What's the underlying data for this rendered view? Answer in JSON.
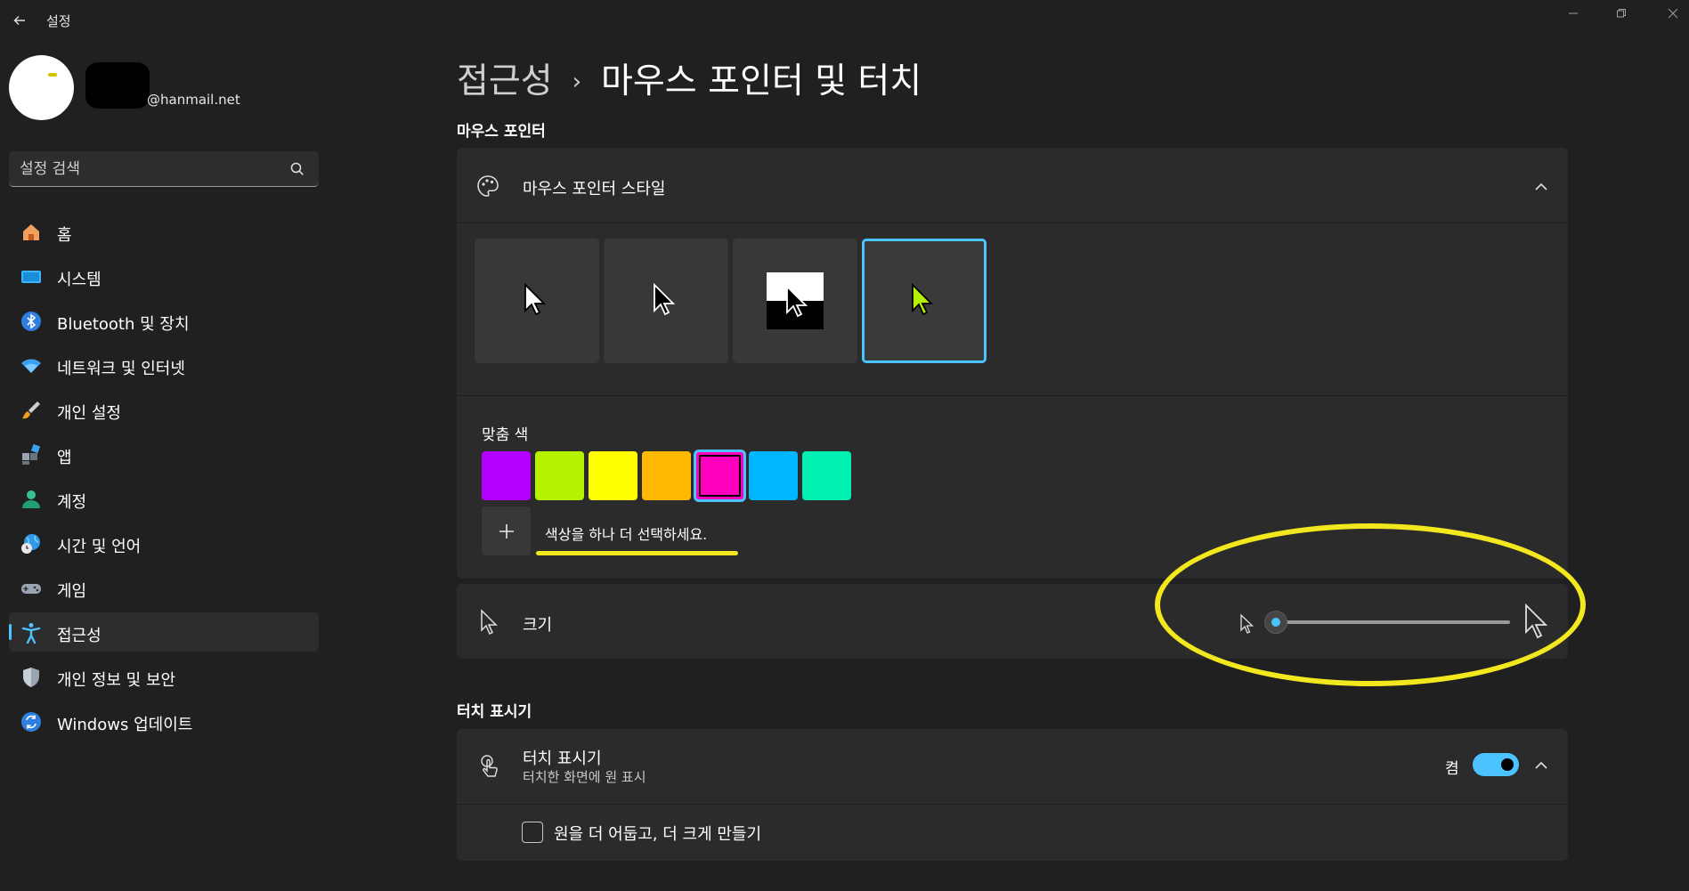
{
  "app": {
    "title": "설정"
  },
  "profile": {
    "email": "@hanmail.net"
  },
  "search": {
    "placeholder": "설정 검색"
  },
  "sidebar": {
    "items": [
      {
        "label": "홈",
        "icon": "home-icon"
      },
      {
        "label": "시스템",
        "icon": "system-icon"
      },
      {
        "label": "Bluetooth 및 장치",
        "icon": "bluetooth-icon"
      },
      {
        "label": "네트워크 및 인터넷",
        "icon": "wifi-icon"
      },
      {
        "label": "개인 설정",
        "icon": "brush-icon"
      },
      {
        "label": "앱",
        "icon": "apps-icon"
      },
      {
        "label": "계정",
        "icon": "account-icon"
      },
      {
        "label": "시간 및 언어",
        "icon": "globe-clock-icon"
      },
      {
        "label": "게임",
        "icon": "gamepad-icon"
      },
      {
        "label": "접근성",
        "icon": "accessibility-icon",
        "selected": true
      },
      {
        "label": "개인 정보 및 보안",
        "icon": "shield-icon"
      },
      {
        "label": "Windows 업데이트",
        "icon": "update-icon"
      }
    ]
  },
  "breadcrumb": {
    "parent": "접근성",
    "separator": "›",
    "current": "마우스 포인터 및 터치"
  },
  "mouse_pointer": {
    "section_title": "마우스 포인터",
    "style_card_title": "마우스 포인터 스타일",
    "styles": [
      "white",
      "black",
      "inverted",
      "custom"
    ],
    "selected_style": "custom",
    "custom_color_label": "맞춤 색",
    "colors": [
      "#b400ff",
      "#b5f200",
      "#ffff00",
      "#ffb900",
      "#ff00bf",
      "#00b7ff",
      "#00f0b1"
    ],
    "selected_color": "#ff00bf",
    "add_color_label": "색상을 하나 더 선택하세요.",
    "size_label": "크기",
    "size_value": 1
  },
  "touch_indicator": {
    "section_title": "터치 표시기",
    "card_title": "터치 표시기",
    "card_subtitle": "터치한 화면에 원 표시",
    "state_label": "켬",
    "enabled": true,
    "option_label": "원을 더 어둡고, 더 크게 만들기",
    "option_checked": false
  },
  "colors": {
    "accent": "#4cc2ff",
    "annotation": "#f3e71e",
    "background": "#202020",
    "card": "#2b2b2b"
  }
}
